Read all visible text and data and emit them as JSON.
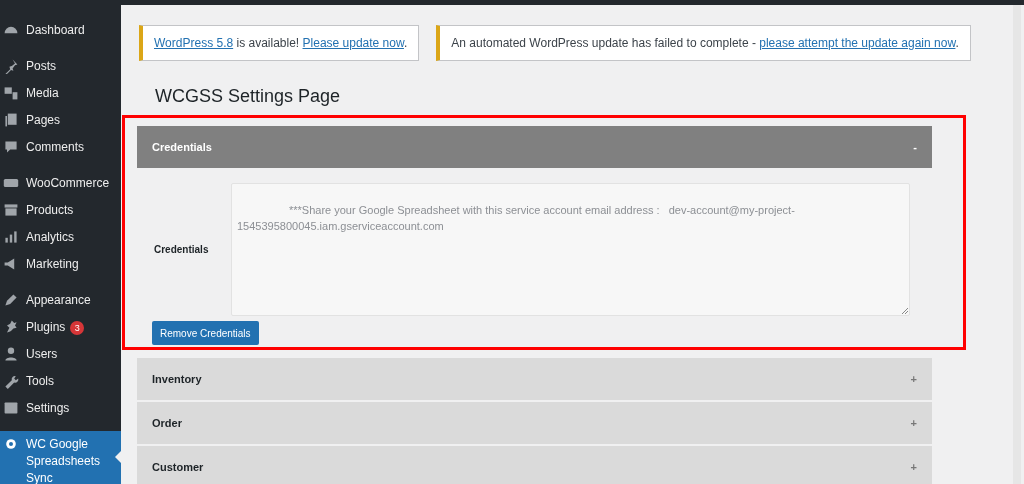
{
  "sidebar": {
    "groups": [
      [
        {
          "label": "Dashboard",
          "selected": false
        }
      ],
      [
        {
          "label": "Posts",
          "selected": false
        },
        {
          "label": "Media",
          "selected": false
        },
        {
          "label": "Pages",
          "selected": false
        },
        {
          "label": "Comments",
          "selected": false
        }
      ],
      [
        {
          "label": "WooCommerce",
          "selected": false
        },
        {
          "label": "Products",
          "selected": false
        },
        {
          "label": "Analytics",
          "selected": false
        },
        {
          "label": "Marketing",
          "selected": false
        }
      ],
      [
        {
          "label": "Appearance",
          "selected": false
        },
        {
          "label": "Plugins",
          "selected": false,
          "badge": "3"
        },
        {
          "label": "Users",
          "selected": false
        },
        {
          "label": "Tools",
          "selected": false
        },
        {
          "label": "Settings",
          "selected": false
        }
      ],
      [
        {
          "label": "WC Google Spreadsheets Sync",
          "selected": true
        }
      ]
    ]
  },
  "notices": [
    {
      "parts": [
        {
          "text": "WordPress 5.8",
          "kind": "link"
        },
        {
          "text": " is available! ",
          "kind": "text"
        },
        {
          "text": "Please update now",
          "kind": "link"
        },
        {
          "text": ".",
          "kind": "text"
        }
      ]
    },
    {
      "parts": [
        {
          "text": "An automated WordPress update has failed to complete - ",
          "kind": "text"
        },
        {
          "text": "please attempt the update again now",
          "kind": "link"
        },
        {
          "text": ".",
          "kind": "text"
        }
      ]
    }
  ],
  "page_title": "WCGSS Settings Page",
  "sections": [
    {
      "title": "Credentials",
      "toggle": "-",
      "expanded": true,
      "field_label": "Credentials",
      "field_value": "***Share your Google Spreadsheet with this service account email address :   dev-account@my-project-1545395800045.iam.gserviceaccount.com",
      "button": "Remove Credentials"
    },
    {
      "title": "Inventory",
      "toggle": "+",
      "expanded": false
    },
    {
      "title": "Order",
      "toggle": "+",
      "expanded": false
    },
    {
      "title": "Customer",
      "toggle": "+",
      "expanded": false
    }
  ]
}
